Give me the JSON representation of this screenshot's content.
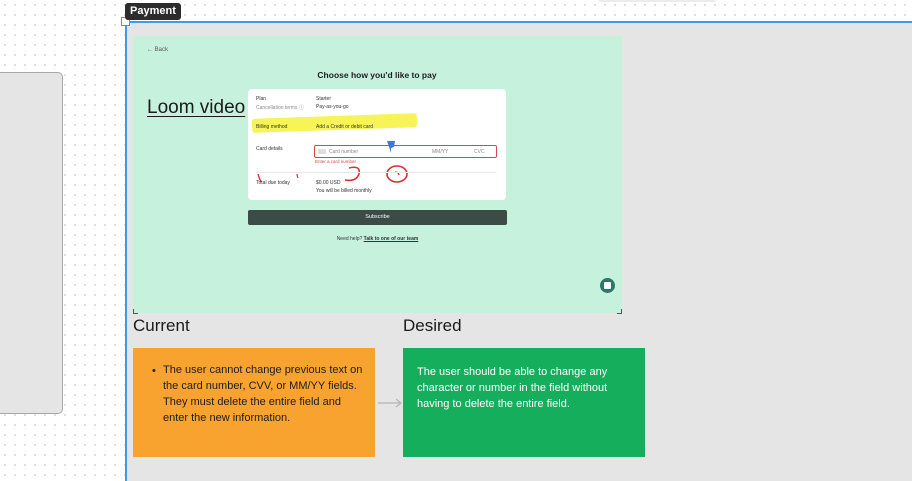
{
  "frame": {
    "label": "Payment"
  },
  "video": {
    "back_label": "← Back",
    "overlay_title": "Loom video",
    "title": "Choose how you'd like to pay",
    "plan_label": "Plan",
    "plan_value": "Starter",
    "cancellation_label": "Cancellation terms ⓘ",
    "cancellation_value": "Pay-as-you-go",
    "billing_label": "Billing method",
    "billing_value": "Add a Credit or debit card",
    "card_details_label": "Card details",
    "card_number_placeholder": "Card number",
    "expiry_placeholder": "MM/YY",
    "cvc_placeholder": "CVC",
    "error_text": "Enter a card number",
    "total_label": "Total due today",
    "total_value": "$0.00 USD",
    "billing_note": "You will be billed monthly",
    "subscribe_label": "Subscribe",
    "help_text": "Need help?",
    "help_link": "Talk to one of our team"
  },
  "current": {
    "title": "Current",
    "text": "The user cannot change previous text on the card number, CVV, or MM/YY fields. They must delete the entire field and enter the new information."
  },
  "desired": {
    "title": "Desired",
    "text": "The user should be able to change any character or number in the field without having to delete the entire field."
  },
  "colors": {
    "frame_bg": "#e5e5e5",
    "video_bg": "#c6f2dd",
    "current_note": "#f8a22f",
    "desired_note": "#14ae5c",
    "selection": "#3d9be9",
    "highlight": "#f4f23a",
    "annotation": "#d93030"
  }
}
